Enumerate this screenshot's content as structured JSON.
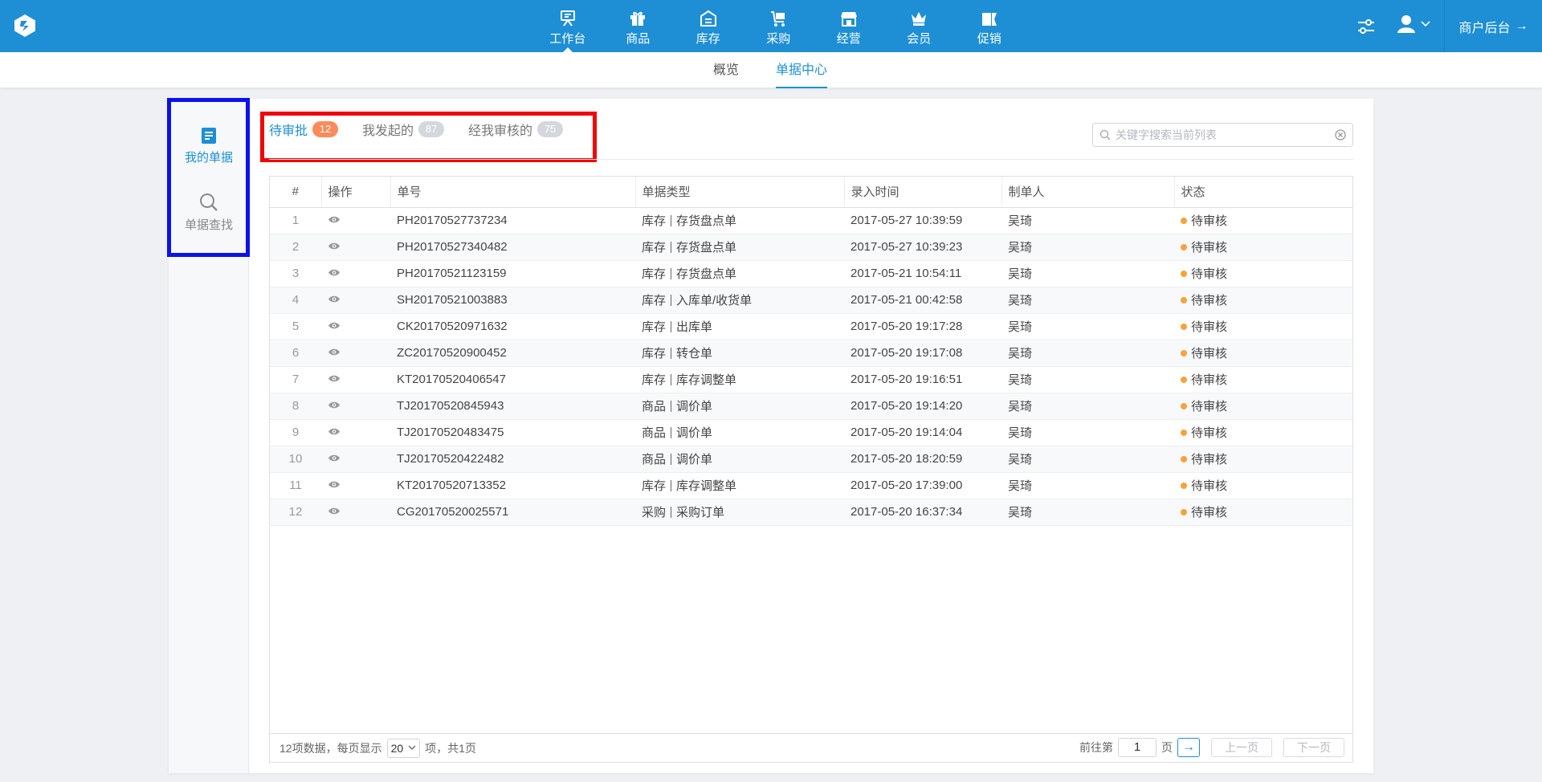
{
  "topnav": {
    "items": [
      {
        "label": "工作台",
        "icon": "workbench-icon"
      },
      {
        "label": "商品",
        "icon": "gift-icon"
      },
      {
        "label": "库存",
        "icon": "warehouse-icon"
      },
      {
        "label": "采购",
        "icon": "cart-icon"
      },
      {
        "label": "经营",
        "icon": "store-icon"
      },
      {
        "label": "会员",
        "icon": "crown-icon"
      },
      {
        "label": "促销",
        "icon": "ticket-icon"
      }
    ],
    "active_index": 0,
    "merchant_label": "商户后台",
    "merchant_arrow": "→"
  },
  "subnav": {
    "items": [
      "概览",
      "单据中心"
    ],
    "active_index": 1
  },
  "sidebar": {
    "items": [
      {
        "label": "我的单据",
        "icon": "document-icon"
      },
      {
        "label": "单据查找",
        "icon": "search-icon"
      }
    ]
  },
  "tabs": [
    {
      "label": "待审批",
      "count": "12"
    },
    {
      "label": "我发起的",
      "count": "87"
    },
    {
      "label": "经我审核的",
      "count": "75"
    }
  ],
  "search": {
    "placeholder": "关键字搜索当前列表"
  },
  "table": {
    "columns": [
      "#",
      "操作",
      "单号",
      "单据类型",
      "录入时间",
      "制单人",
      "状态"
    ],
    "rows": [
      {
        "idx": "1",
        "no": "PH20170527737234",
        "cat": "库存",
        "type": "存货盘点单",
        "time": "2017-05-27 10:39:59",
        "maker": "吴琦",
        "status": "待审核"
      },
      {
        "idx": "2",
        "no": "PH20170527340482",
        "cat": "库存",
        "type": "存货盘点单",
        "time": "2017-05-27 10:39:23",
        "maker": "吴琦",
        "status": "待审核"
      },
      {
        "idx": "3",
        "no": "PH20170521123159",
        "cat": "库存",
        "type": "存货盘点单",
        "time": "2017-05-21 10:54:11",
        "maker": "吴琦",
        "status": "待审核"
      },
      {
        "idx": "4",
        "no": "SH20170521003883",
        "cat": "库存",
        "type": "入库单/收货单",
        "time": "2017-05-21 00:42:58",
        "maker": "吴琦",
        "status": "待审核"
      },
      {
        "idx": "5",
        "no": "CK20170520971632",
        "cat": "库存",
        "type": "出库单",
        "time": "2017-05-20 19:17:28",
        "maker": "吴琦",
        "status": "待审核"
      },
      {
        "idx": "6",
        "no": "ZC20170520900452",
        "cat": "库存",
        "type": "转仓单",
        "time": "2017-05-20 19:17:08",
        "maker": "吴琦",
        "status": "待审核"
      },
      {
        "idx": "7",
        "no": "KT20170520406547",
        "cat": "库存",
        "type": "库存调整单",
        "time": "2017-05-20 19:16:51",
        "maker": "吴琦",
        "status": "待审核"
      },
      {
        "idx": "8",
        "no": "TJ20170520845943",
        "cat": "商品",
        "type": "调价单",
        "time": "2017-05-20 19:14:20",
        "maker": "吴琦",
        "status": "待审核"
      },
      {
        "idx": "9",
        "no": "TJ20170520483475",
        "cat": "商品",
        "type": "调价单",
        "time": "2017-05-20 19:14:04",
        "maker": "吴琦",
        "status": "待审核"
      },
      {
        "idx": "10",
        "no": "TJ20170520422482",
        "cat": "商品",
        "type": "调价单",
        "time": "2017-05-20 18:20:59",
        "maker": "吴琦",
        "status": "待审核"
      },
      {
        "idx": "11",
        "no": "KT20170520713352",
        "cat": "库存",
        "type": "库存调整单",
        "time": "2017-05-20 17:39:00",
        "maker": "吴琦",
        "status": "待审核"
      },
      {
        "idx": "12",
        "no": "CG20170520025571",
        "cat": "采购",
        "type": "采购订单",
        "time": "2017-05-20 16:37:34",
        "maker": "吴琦",
        "status": "待审核"
      }
    ]
  },
  "footer": {
    "summary_prefix": "12项数据，每页显示",
    "per_page": "20",
    "summary_suffix": "项，共1页",
    "goto_label": "前往第",
    "page_value": "1",
    "page_unit": "页",
    "go_arrow": "→",
    "prev_label": "上一页",
    "next_label": "下一页"
  },
  "colors": {
    "brand": "#1e8fd5",
    "badge_active": "#fb8b5b",
    "badge_inactive": "#d4d8dd",
    "status_dot": "#f7a23b",
    "annotation_blue": "#0b12e8",
    "annotation_red": "#f00606"
  }
}
